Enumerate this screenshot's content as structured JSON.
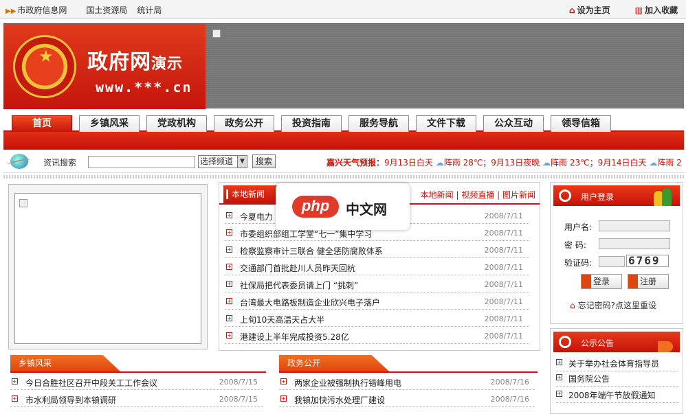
{
  "topbar": {
    "links": [
      "市政府信息网",
      "国土资源局",
      "统计局"
    ],
    "set_home": "设为主页",
    "add_favorite": "加入收藏"
  },
  "logo": {
    "title": "政府网",
    "title_suffix": "演示",
    "url": "www.***.cn"
  },
  "nav": {
    "tabs": [
      "首页",
      "乡镇风采",
      "党政机构",
      "政务公开",
      "投资指南",
      "服务导航",
      "文件下载",
      "公众互动",
      "领导信箱"
    ]
  },
  "search": {
    "label": "资讯搜索",
    "channel": "选择频道",
    "button": "搜索",
    "weather_label": "嘉兴天气预报：",
    "weather": [
      "9月13日白天",
      "阵雨 28℃；9月13日夜晚",
      "阵雨 23℃；9月14日白天",
      "阵雨 2"
    ]
  },
  "local_news": {
    "title": "本地新闻",
    "links": "本地新闻 | 视频直播 | 图片新闻",
    "items": [
      {
        "title": "今夏电力",
        "date": "2008/7/11"
      },
      {
        "title": "市委组织部组工学堂“七一”集中学习",
        "date": "2008/7/11"
      },
      {
        "title": "检察监察审计三联合  健全惩防腐败体系",
        "date": "2008/7/11"
      },
      {
        "title": "交通部门首批赴川人员昨天回杭",
        "date": "2008/7/11"
      },
      {
        "title": "社保局把代表委员请上门 “挑刺”",
        "date": "2008/7/11"
      },
      {
        "title": "台湾最大电路板制造企业欣兴电子落户",
        "date": "2008/7/11"
      },
      {
        "title": "上旬10天高温天占大半",
        "date": "2008/7/11"
      },
      {
        "title": "港建设上半年完成投资5.28亿",
        "date": "2008/7/11"
      }
    ]
  },
  "watermark": {
    "php": "php",
    "cn": "中文网"
  },
  "township": {
    "title": "乡镇风采",
    "items": [
      {
        "title": "今日合胜社区召开中段关工工作会议",
        "date": "2008/7/15"
      },
      {
        "title": "市水利局领导到本镇调研",
        "date": "2008/7/15"
      }
    ]
  },
  "affairs": {
    "title": "政务公开",
    "items": [
      {
        "title": "两家企业被强制执行错峰用电",
        "date": "2008/7/16"
      },
      {
        "title": "我镇加快污水处理厂建设",
        "date": "2008/7/16"
      }
    ]
  },
  "login": {
    "title": "用户登录",
    "username_label": "用户名:",
    "password_label": "密  码:",
    "captcha_label": "验证码:",
    "captcha": "6769",
    "login_button": "登录",
    "register_button": "注册",
    "forgot": "忘记密码?点这里重设"
  },
  "notice": {
    "title": "公示公告",
    "items": [
      "关于举办社会体育指导员",
      "国务院公告",
      "2008年端午节放假通知"
    ]
  }
}
